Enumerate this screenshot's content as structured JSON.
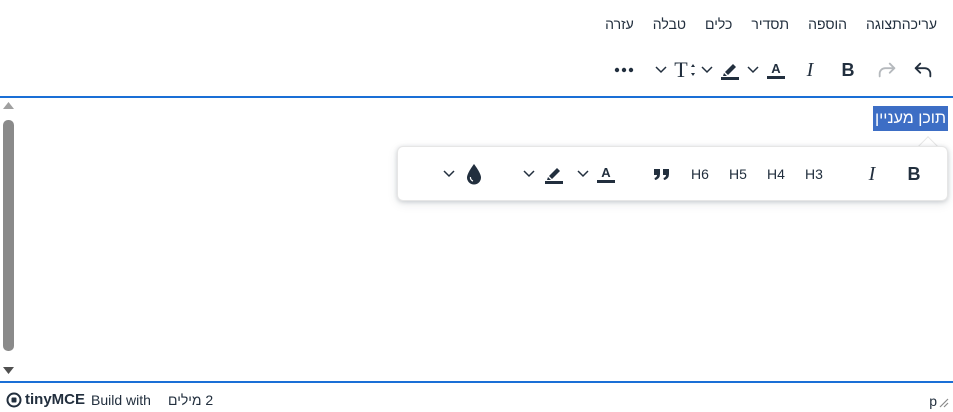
{
  "menubar": {
    "items": [
      {
        "id": "edit",
        "label": "עריכה"
      },
      {
        "id": "view",
        "label": "תצוגה"
      },
      {
        "id": "insert",
        "label": "הוספה"
      },
      {
        "id": "format",
        "label": "תסדיר"
      },
      {
        "id": "tools",
        "label": "כלים"
      },
      {
        "id": "table",
        "label": "טבלה"
      },
      {
        "id": "help",
        "label": "עזרה"
      }
    ]
  },
  "toolbar": {
    "icons": [
      "undo-icon",
      "redo-icon",
      "bold-icon",
      "italic-icon",
      "text-color-icon",
      "highlight-icon",
      "font-size-icon",
      "more-icon"
    ]
  },
  "content": {
    "selected_text": "תוכן מעניין"
  },
  "quickbar": {
    "headings": [
      "H3",
      "H4",
      "H5",
      "H6"
    ],
    "icons": [
      "bold-icon",
      "italic-icon",
      "blockquote-icon",
      "text-color-icon",
      "highlight-icon",
      "color-drop-icon"
    ]
  },
  "statusbar": {
    "brand": "tinyMCE",
    "build_label": "Build with",
    "word_count": "2 מילים",
    "element_path": "p"
  },
  "colors": {
    "accent": "#1a6fd6",
    "selection": "#3d6ec5",
    "icon": "#222f3e"
  }
}
